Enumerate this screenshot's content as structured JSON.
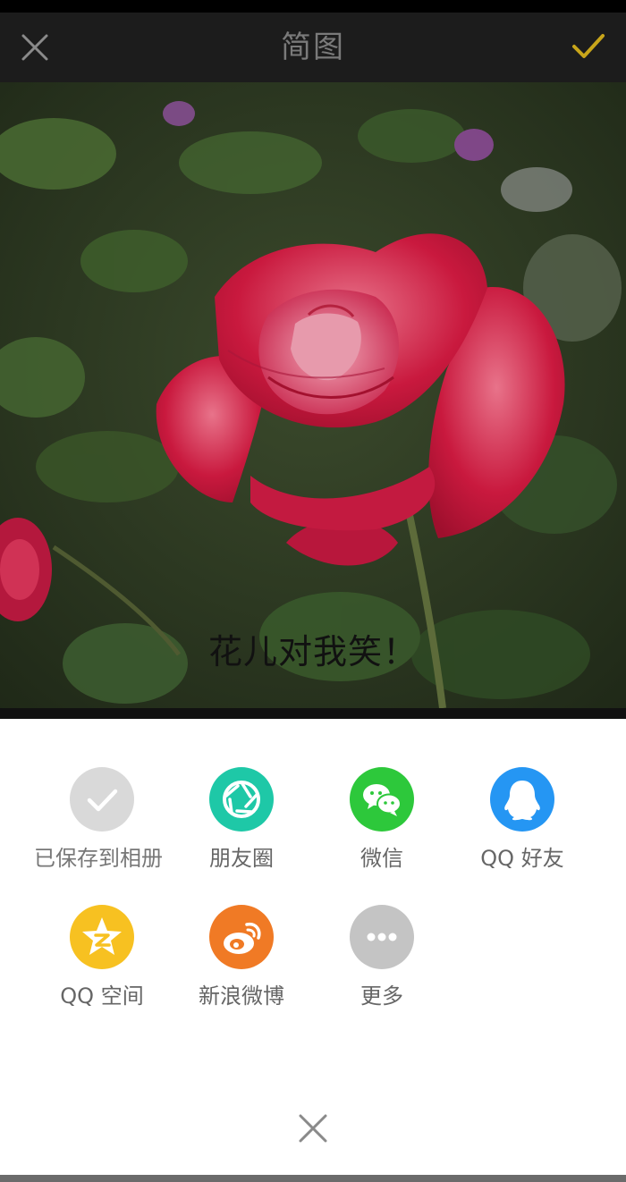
{
  "header": {
    "title": "简图"
  },
  "photo": {
    "caption": "花儿对我笑！"
  },
  "share": {
    "items": [
      {
        "label": "已保存到相册",
        "icon": "check-icon",
        "color": "#d9d9d9"
      },
      {
        "label": "朋友圈",
        "icon": "moments-shutter-icon",
        "color": "#1ec8a7"
      },
      {
        "label": "微信",
        "icon": "wechat-icon",
        "color": "#2dc83b"
      },
      {
        "label": "QQ 好友",
        "icon": "qq-penguin-icon",
        "color": "#2596f3"
      },
      {
        "label": "QQ 空间",
        "icon": "qzone-star-icon",
        "color": "#f7c121"
      },
      {
        "label": "新浪微博",
        "icon": "weibo-icon",
        "color": "#f07a25"
      },
      {
        "label": "更多",
        "icon": "more-dots-icon",
        "color": "#c4c4c4"
      }
    ]
  },
  "colors": {
    "accent_check": "#c8a51a",
    "topbar_bg": "#1c1c1c"
  }
}
